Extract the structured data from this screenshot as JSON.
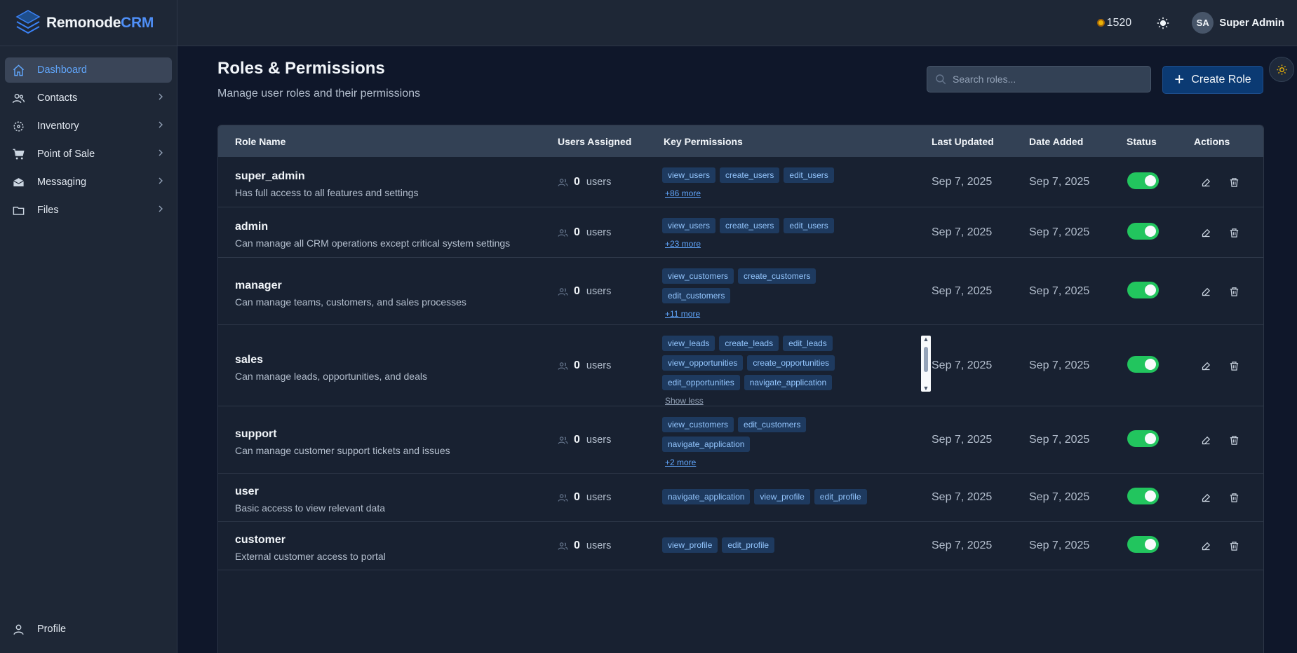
{
  "brand": {
    "name_main": "Remonode",
    "name_accent": "CRM"
  },
  "topbar": {
    "coins": "1520",
    "user_initials": "SA",
    "user_name": "Super Admin"
  },
  "sidebar": {
    "items": [
      {
        "label": "Dashboard",
        "icon": "home-icon",
        "active": true
      },
      {
        "label": "Contacts",
        "icon": "users-icon"
      },
      {
        "label": "Inventory",
        "icon": "box-icon"
      },
      {
        "label": "Point of Sale",
        "icon": "cart-icon"
      },
      {
        "label": "Messaging",
        "icon": "inbox-icon"
      },
      {
        "label": "Files",
        "icon": "folder-icon"
      }
    ],
    "profile_label": "Profile"
  },
  "page": {
    "title": "Roles & Permissions",
    "subtitle": "Manage user roles and their permissions",
    "search_placeholder": "Search roles...",
    "create_label": "Create Role"
  },
  "table": {
    "headers": [
      "Role Name",
      "Users Assigned",
      "Key Permissions",
      "Last Updated",
      "Date Added",
      "Status",
      "Actions"
    ],
    "rows": [
      {
        "name": "super_admin",
        "desc": "Has full access to all features and settings",
        "count": "0",
        "users_label": "users",
        "perm_lines": [
          [
            "view_users",
            "create_users",
            "edit_users"
          ]
        ],
        "more": "+86 more",
        "last_updated": "Sep 7, 2025",
        "date_added": "Sep 7, 2025",
        "active": true
      },
      {
        "name": "admin",
        "desc": "Can manage all CRM operations except critical system settings",
        "count": "0",
        "users_label": "users",
        "perm_lines": [
          [
            "view_users",
            "create_users",
            "edit_users"
          ]
        ],
        "more": "+23 more",
        "last_updated": "Sep 7, 2025",
        "date_added": "Sep 7, 2025",
        "active": true
      },
      {
        "name": "manager",
        "desc": "Can manage teams, customers, and sales processes",
        "count": "0",
        "users_label": "users",
        "perm_lines": [
          [
            "view_customers",
            "create_customers"
          ],
          [
            "edit_customers"
          ]
        ],
        "more": "+11 more",
        "last_updated": "Sep 7, 2025",
        "date_added": "Sep 7, 2025",
        "active": true
      },
      {
        "name": "sales",
        "desc": "Can manage leads, opportunities, and deals",
        "count": "0",
        "users_label": "users",
        "perm_lines": [
          [
            "view_leads",
            "create_leads",
            "edit_leads"
          ],
          [
            "view_opportunities",
            "create_opportunities"
          ],
          [
            "edit_opportunities",
            "navigate_application"
          ]
        ],
        "less": "Show less",
        "last_updated": "Sep 7, 2025",
        "date_added": "Sep 7, 2025",
        "active": true
      },
      {
        "name": "support",
        "desc": "Can manage customer support tickets and issues",
        "count": "0",
        "users_label": "users",
        "perm_lines": [
          [
            "view_customers",
            "edit_customers"
          ],
          [
            "navigate_application"
          ]
        ],
        "more": "+2 more",
        "last_updated": "Sep 7, 2025",
        "date_added": "Sep 7, 2025",
        "active": true
      },
      {
        "name": "user",
        "desc": "Basic access to view relevant data",
        "count": "0",
        "users_label": "users",
        "perm_lines": [
          [
            "navigate_application",
            "view_profile",
            "edit_profile"
          ]
        ],
        "last_updated": "Sep 7, 2025",
        "date_added": "Sep 7, 2025",
        "active": true
      },
      {
        "name": "customer",
        "desc": "External customer access to portal",
        "count": "0",
        "users_label": "users",
        "perm_lines": [
          [
            "view_profile",
            "edit_profile"
          ]
        ],
        "last_updated": "Sep 7, 2025",
        "date_added": "Sep 7, 2025",
        "active": true
      }
    ]
  },
  "colors": {
    "accent": "#4f8ff7",
    "toggle_on": "#22c55e",
    "tag_bg": "#1e3a5f",
    "tag_text": "#93c5fd"
  }
}
